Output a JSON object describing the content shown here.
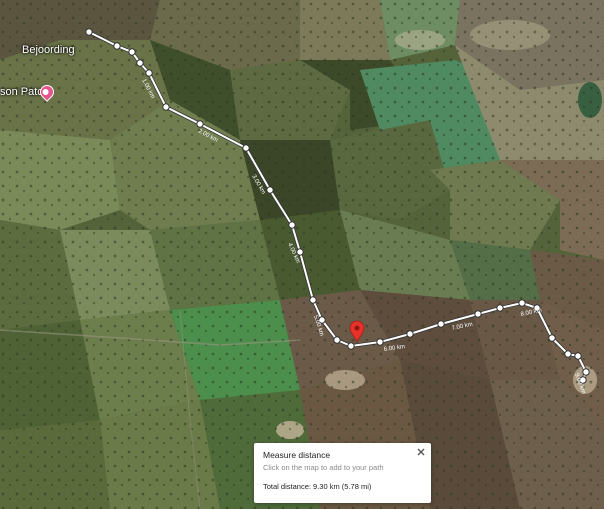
{
  "map": {
    "places": [
      {
        "id": "bejoording",
        "label": "Bejoording"
      },
      {
        "id": "patch",
        "label": "son Patch"
      }
    ]
  },
  "route": {
    "distance_labels": [
      "1.00 km",
      "2.00 km",
      "3.00 km",
      "4.00 km",
      "5.00 km",
      "6.00 km",
      "7.00 km",
      "8.00 km",
      "9.00 km"
    ]
  },
  "measure_panel": {
    "title": "Measure distance",
    "hint": "Click on the map to add to your path",
    "total_label": "Total distance:",
    "total_value": "9.30 km (5.78 mi)"
  },
  "colors": {
    "route_line": "#ffffff",
    "route_outline": "#333333",
    "marker": "#e8312b",
    "poi_pin": "#e5568d"
  },
  "icons": {
    "close": "close-icon",
    "marker": "map-pin-icon",
    "poi": "poi-pin-icon"
  }
}
